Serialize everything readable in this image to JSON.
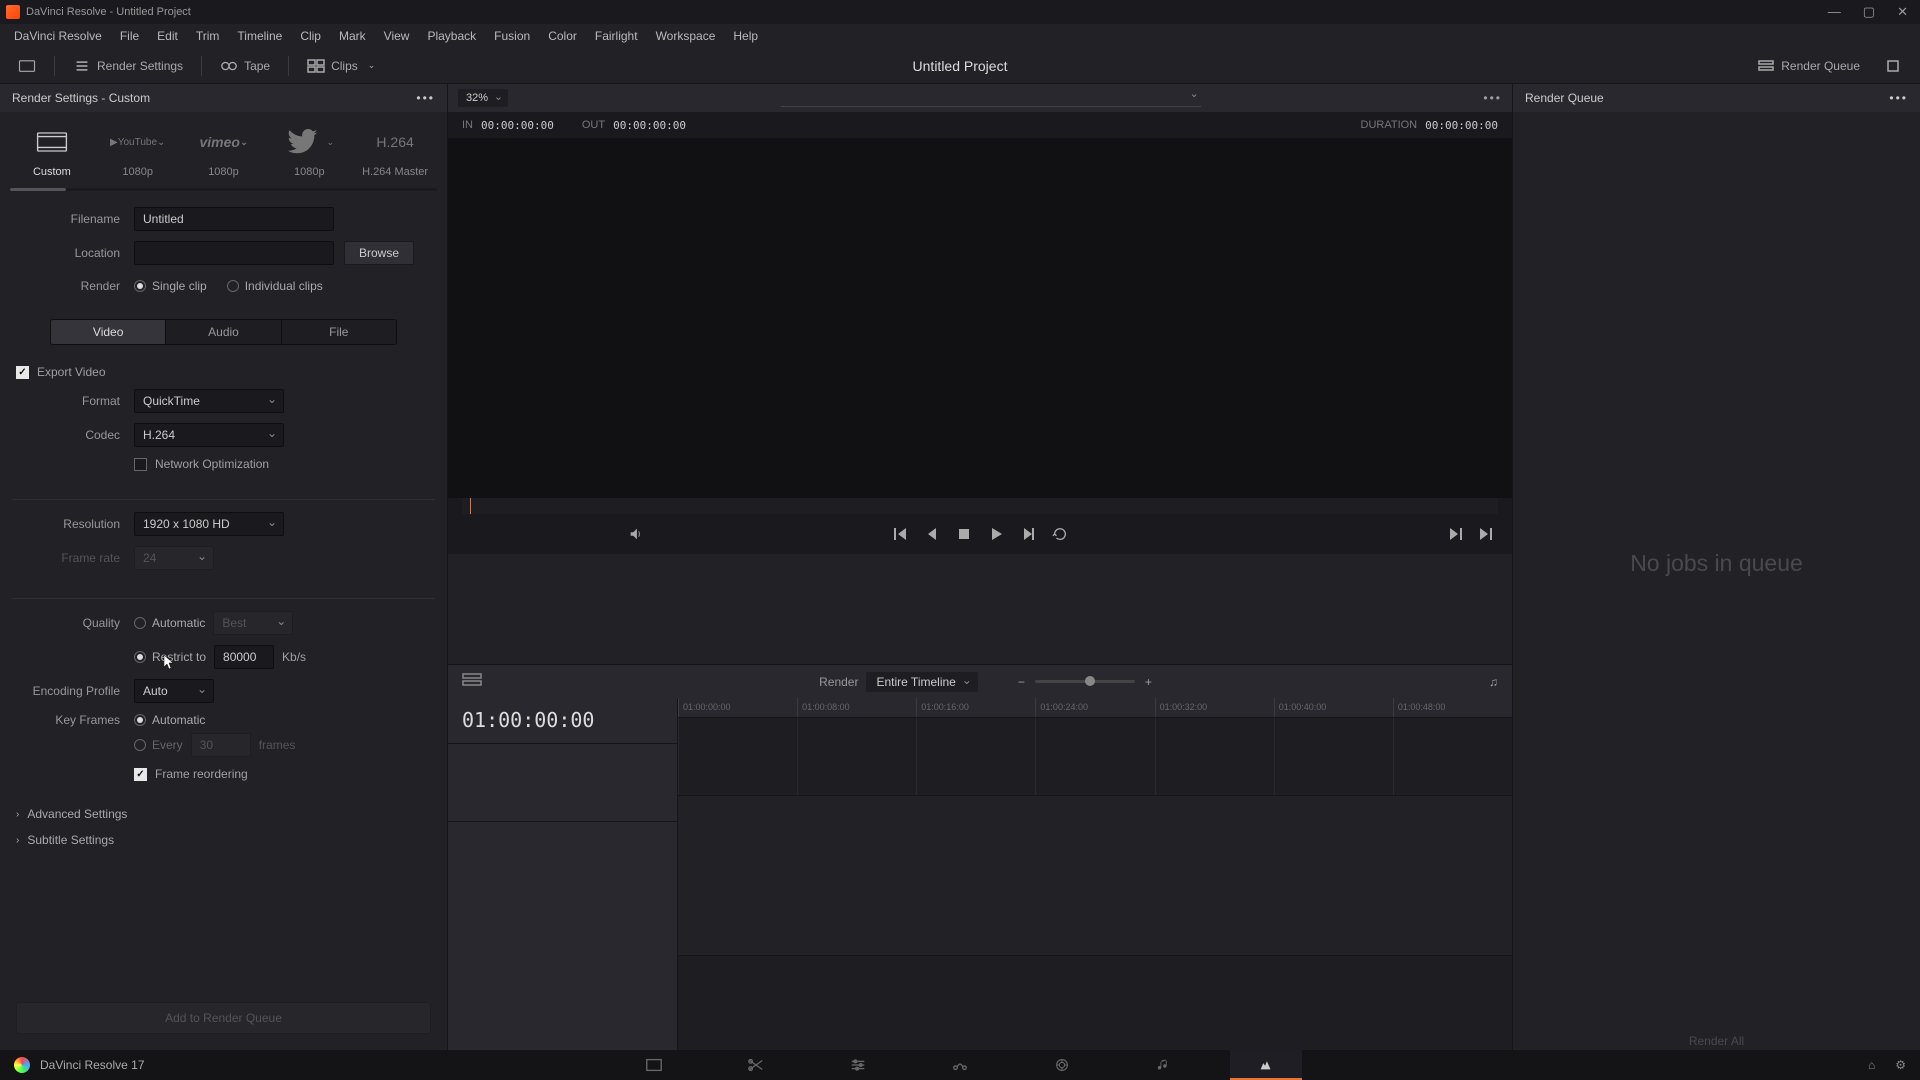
{
  "window_title": "DaVinci Resolve - Untitled Project",
  "menu": [
    "DaVinci Resolve",
    "File",
    "Edit",
    "Trim",
    "Timeline",
    "Clip",
    "Mark",
    "View",
    "Playback",
    "Fusion",
    "Color",
    "Fairlight",
    "Workspace",
    "Help"
  ],
  "toolbar": {
    "render_settings": "Render Settings",
    "tape": "Tape",
    "clips": "Clips",
    "project": "Untitled Project",
    "render_queue": "Render Queue"
  },
  "panel_title": "Render Settings - Custom",
  "presets": [
    {
      "label": "Custom",
      "active": true
    },
    {
      "label": "1080p"
    },
    {
      "label": "1080p"
    },
    {
      "label": "1080p"
    },
    {
      "label": "H.264 Master"
    }
  ],
  "preset_icons": {
    "youtube": "YouTube",
    "vimeo": "vimeo",
    "twitter": "",
    "h264": "H.264"
  },
  "form": {
    "filename_label": "Filename",
    "filename": "Untitled",
    "location_label": "Location",
    "location": "",
    "browse": "Browse",
    "render_label": "Render",
    "single_clip": "Single clip",
    "individual_clips": "Individual clips",
    "tabs": {
      "video": "Video",
      "audio": "Audio",
      "file": "File"
    },
    "export_video": "Export Video",
    "format_label": "Format",
    "format": "QuickTime",
    "codec_label": "Codec",
    "codec": "H.264",
    "network_opt": "Network Optimization",
    "resolution_label": "Resolution",
    "resolution": "1920 x 1080 HD",
    "framerate_label": "Frame rate",
    "framerate": "24",
    "quality_label": "Quality",
    "quality_auto": "Automatic",
    "quality_best": "Best",
    "restrict_to": "Restrict to",
    "restrict_value": "80000",
    "kbs": "Kb/s",
    "enc_profile_label": "Encoding Profile",
    "enc_profile": "Auto",
    "keyframes_label": "Key Frames",
    "kf_auto": "Automatic",
    "kf_every": "Every",
    "kf_every_val": "30",
    "kf_frames": "frames",
    "frame_reorder": "Frame reordering",
    "advanced": "Advanced Settings",
    "subtitle": "Subtitle Settings",
    "add_to_queue": "Add to Render Queue"
  },
  "viewer": {
    "zoom": "32%",
    "in_label": "IN",
    "in": "00:00:00:00",
    "out_label": "OUT",
    "out": "00:00:00:00",
    "duration_label": "DURATION",
    "duration": "00:00:00:00"
  },
  "timeline": {
    "render_label": "Render",
    "render_scope": "Entire Timeline",
    "tc": "01:00:00:00",
    "ticks": [
      "01:00:00:00",
      "01:00:08:00",
      "01:00:16:00",
      "01:00:24:00",
      "01:00:32:00",
      "01:00:40:00",
      "01:00:48:00"
    ]
  },
  "queue": {
    "title": "Render Queue",
    "empty": "No jobs in queue",
    "render_all": "Render All"
  },
  "footer": {
    "app": "DaVinci Resolve 17"
  }
}
